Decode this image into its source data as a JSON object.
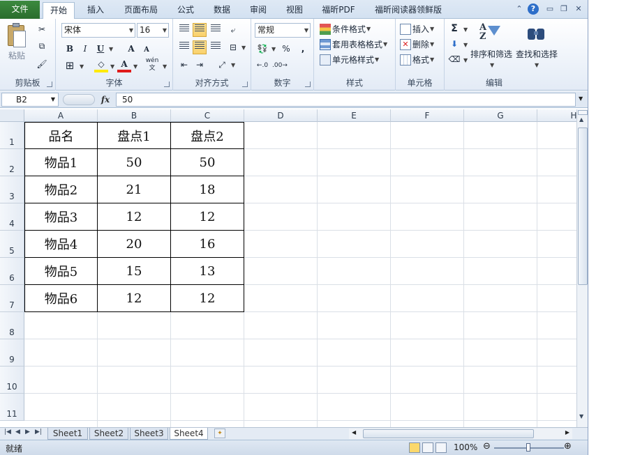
{
  "tabs": {
    "file": "文件",
    "items": [
      "开始",
      "插入",
      "页面布局",
      "公式",
      "数据",
      "审阅",
      "视图",
      "福昕PDF",
      "福昕阅读器领鲜版"
    ],
    "active": "开始"
  },
  "ribbon": {
    "clipboard": {
      "label": "剪贴板",
      "paste": "粘贴"
    },
    "font": {
      "label": "字体",
      "name": "宋体",
      "size": "16",
      "bold": "B",
      "italic": "I",
      "underline": "U",
      "grow": "A",
      "shrink": "A",
      "wen": "wén\n文"
    },
    "alignment": {
      "label": "对齐方式"
    },
    "number": {
      "label": "数字",
      "format": "常规",
      "percent": "%",
      "comma": ","
    },
    "styles": {
      "label": "样式",
      "conditional": "条件格式",
      "table": "套用表格格式",
      "cell": "单元格样式"
    },
    "cells": {
      "label": "单元格",
      "insert": "插入",
      "delete": "删除",
      "format": "格式"
    },
    "editing": {
      "label": "编辑",
      "sum": "Σ",
      "sort": "排序和筛选",
      "find": "查找和选择"
    }
  },
  "formula_bar": {
    "name_box": "B2",
    "fx": "fx",
    "value": "50"
  },
  "grid": {
    "columns": [
      "A",
      "B",
      "C",
      "D",
      "E",
      "F",
      "G",
      "H"
    ],
    "rows": [
      "1",
      "2",
      "3",
      "4",
      "5",
      "6",
      "7",
      "8",
      "9",
      "10",
      "11"
    ],
    "table": {
      "headers": [
        "品名",
        "盘点1",
        "盘点2"
      ],
      "rows": [
        [
          "物品1",
          "50",
          "50"
        ],
        [
          "物品2",
          "21",
          "18"
        ],
        [
          "物品3",
          "12",
          "12"
        ],
        [
          "物品4",
          "20",
          "16"
        ],
        [
          "物品5",
          "15",
          "13"
        ],
        [
          "物品6",
          "12",
          "12"
        ]
      ]
    }
  },
  "sheets": [
    "Sheet1",
    "Sheet2",
    "Sheet3",
    "Sheet4"
  ],
  "active_sheet": "Sheet4",
  "status": {
    "text": "就绪",
    "zoom": "100%"
  }
}
